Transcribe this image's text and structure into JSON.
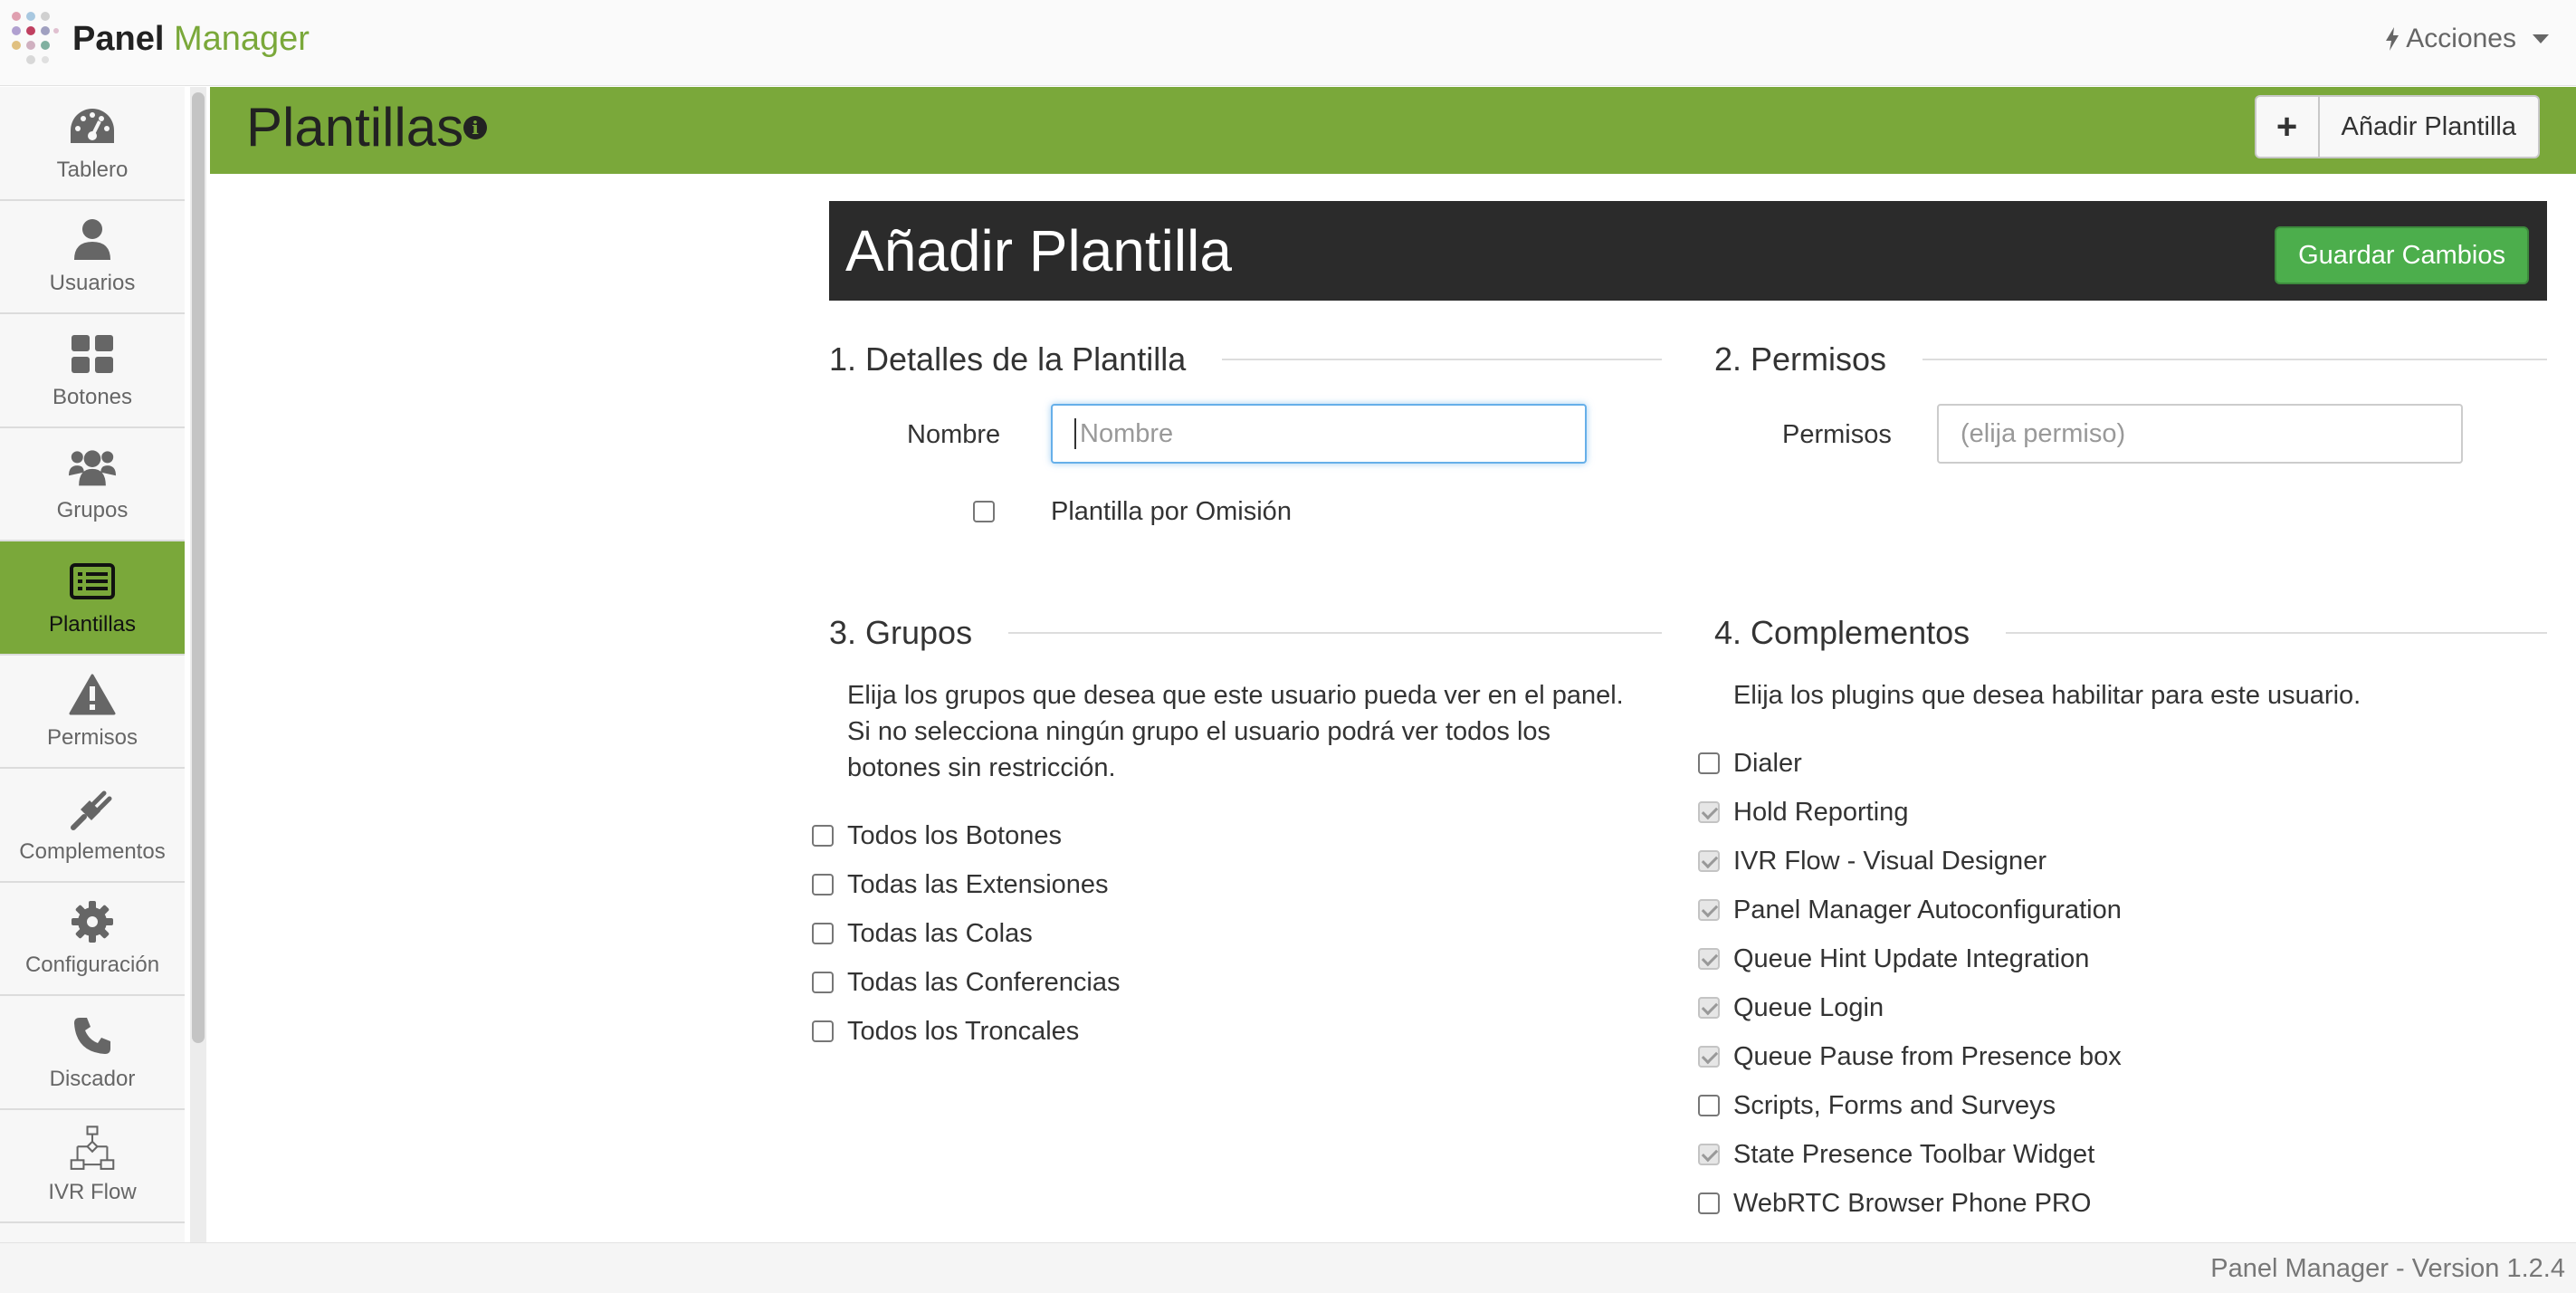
{
  "app": {
    "brand_bold": "Panel",
    "brand_accent": "Manager",
    "actions_label": "Acciones"
  },
  "sidebar": {
    "items": [
      {
        "label": "Tablero",
        "icon": "dashboard-icon"
      },
      {
        "label": "Usuarios",
        "icon": "user-icon"
      },
      {
        "label": "Botones",
        "icon": "grid-icon"
      },
      {
        "label": "Grupos",
        "icon": "users-group-icon"
      },
      {
        "label": "Plantillas",
        "icon": "list-alt-icon",
        "active": true
      },
      {
        "label": "Permisos",
        "icon": "warning-icon"
      },
      {
        "label": "Complementos",
        "icon": "plug-icon"
      },
      {
        "label": "Configuración",
        "icon": "gear-icon"
      },
      {
        "label": "Discador",
        "icon": "phone-icon"
      },
      {
        "label": "IVR Flow",
        "icon": "flowchart-icon"
      }
    ]
  },
  "header": {
    "title": "Plantillas",
    "add_button_plus": "+",
    "add_button_label": "Añadir Plantilla"
  },
  "form": {
    "title": "Añadir Plantilla",
    "save_label": "Guardar Cambios",
    "details": {
      "heading": "1. Detalles de la Plantilla",
      "name_label": "Nombre",
      "name_placeholder": "Nombre",
      "default_label": "Plantilla por Omisión"
    },
    "permissions": {
      "heading": "2. Permisos",
      "label": "Permisos",
      "placeholder": "(elija permiso)"
    },
    "groups": {
      "heading": "3. Grupos",
      "description": "Elija los grupos que desea que este usuario pueda ver en el panel. Si no selecciona ningún grupo el usuario podrá ver todos los botones sin restricción.",
      "options": [
        {
          "label": "Todos los Botones",
          "checked": false
        },
        {
          "label": "Todas las Extensiones",
          "checked": false
        },
        {
          "label": "Todas las Colas",
          "checked": false
        },
        {
          "label": "Todas las Conferencias",
          "checked": false
        },
        {
          "label": "Todos los Troncales",
          "checked": false
        }
      ]
    },
    "plugins": {
      "heading": "4. Complementos",
      "description": "Elija los plugins que desea habilitar para este usuario.",
      "options": [
        {
          "label": "Dialer",
          "checked": false
        },
        {
          "label": "Hold Reporting",
          "checked": true
        },
        {
          "label": "IVR Flow - Visual Designer",
          "checked": true
        },
        {
          "label": "Panel Manager Autoconfiguration",
          "checked": true
        },
        {
          "label": "Queue Hint Update Integration",
          "checked": true
        },
        {
          "label": "Queue Login",
          "checked": true
        },
        {
          "label": "Queue Pause from Presence box",
          "checked": true
        },
        {
          "label": "Scripts, Forms and Surveys",
          "checked": false
        },
        {
          "label": "State Presence Toolbar Widget",
          "checked": true
        },
        {
          "label": "WebRTC Browser Phone PRO",
          "checked": false
        }
      ]
    }
  },
  "footer": {
    "version": "Panel Manager - Version 1.2.4"
  },
  "colors": {
    "accent": "#7aa83a",
    "save": "#4cae4c",
    "dark_header": "#2b2b2b"
  }
}
